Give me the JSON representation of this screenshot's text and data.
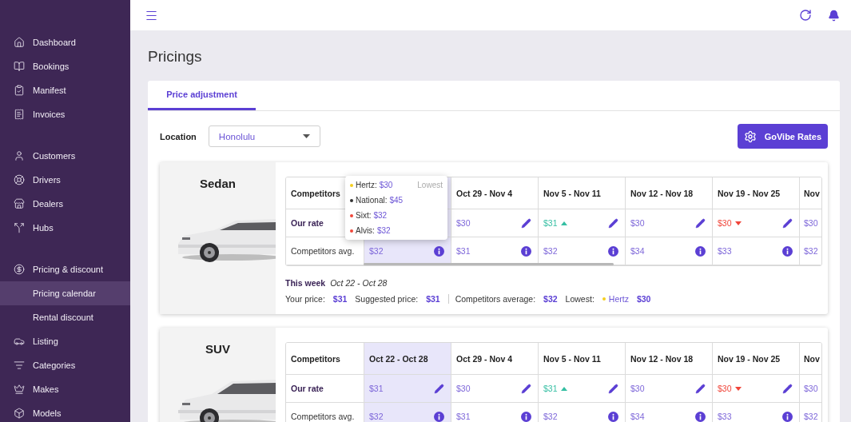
{
  "sidebar": {
    "groups": [
      {
        "items": [
          {
            "label": "Dashboard",
            "selected": false
          },
          {
            "label": "Bookings",
            "selected": false
          },
          {
            "label": "Manifest",
            "selected": false
          },
          {
            "label": "Invoices",
            "selected": false
          }
        ]
      },
      {
        "items": [
          {
            "label": "Customers",
            "selected": false
          },
          {
            "label": "Drivers",
            "selected": false
          },
          {
            "label": "Dealers",
            "selected": false
          },
          {
            "label": "Hubs",
            "selected": false
          }
        ]
      },
      {
        "items": [
          {
            "label": "Pricing & discount",
            "selected": false,
            "expanded": true,
            "children": [
              {
                "label": "Pricing calendar",
                "selected": true
              },
              {
                "label": "Rental discount",
                "selected": false
              }
            ]
          },
          {
            "label": "Listing",
            "selected": false
          },
          {
            "label": "Categories",
            "selected": false
          },
          {
            "label": "Makes",
            "selected": false
          },
          {
            "label": "Models",
            "selected": false
          }
        ]
      }
    ]
  },
  "page": {
    "title": "Pricings"
  },
  "tabs": [
    {
      "label": "Price adjustment",
      "selected": true
    }
  ],
  "location": {
    "label": "Location",
    "value": "Honolulu"
  },
  "rates_button": "GoVibe Rates",
  "vehicles": [
    {
      "name": "Sedan",
      "header": "Competitors",
      "rate_label": "Our rate",
      "avg_label": "Competitors avg.",
      "weeks": [
        {
          "selected": true,
          "avg": "$32"
        },
        {
          "range": "Oct 29 - Nov 4",
          "selected": false,
          "rate": "$30",
          "kind": "flat",
          "avg": "$31"
        },
        {
          "range": "Nov 5 - Nov 11",
          "selected": false,
          "rate": "$31",
          "kind": "up",
          "avg": "$32"
        },
        {
          "range": "Nov 12 - Nov 18",
          "selected": false,
          "rate": "$30",
          "kind": "flat",
          "avg": "$34"
        },
        {
          "range": "Nov 19 - Nov 25",
          "selected": false,
          "rate": "$30",
          "kind": "down",
          "avg": "$33"
        },
        {
          "range": "Nov",
          "selected": false,
          "rate": "$30",
          "kind": "flat",
          "avg": "$32"
        }
      ],
      "tooltip": [
        {
          "name": "Hertz:",
          "price": "$30",
          "color": "#f5cf1f",
          "note": "Lowest"
        },
        {
          "name": "National:",
          "price": "$45",
          "color": "#333333"
        },
        {
          "name": "Sixt:",
          "price": "$32",
          "color": "#f0473a"
        },
        {
          "name": "Alvis:",
          "price": "$32",
          "color": "#f0473a"
        }
      ],
      "this_week": {
        "label": "This week",
        "range": "Oct 22 - Oct 28"
      },
      "summary": [
        {
          "label": "Your price:",
          "value": "$31",
          "separator": false
        },
        {
          "label": "Suggested price:",
          "value": "$31",
          "separator": false
        },
        {
          "label": "Competitors average:",
          "value": "$32",
          "separator": true
        }
      ],
      "lowest": {
        "label": "Lowest:",
        "name": "Hertz",
        "value": "$30",
        "color": "#f5cf1f"
      }
    },
    {
      "name": "SUV",
      "header": "Competitors",
      "rate_label": "Our rate",
      "avg_label": "Competitors avg.",
      "weeks": [
        {
          "range": "Oct 22 - Oct 28",
          "selected": true,
          "rate": "$31",
          "kind": "flat",
          "avg": "$32"
        },
        {
          "range": "Oct 29 - Nov 4",
          "selected": false,
          "rate": "$30",
          "kind": "flat",
          "avg": "$31"
        },
        {
          "range": "Nov 5 - Nov 11",
          "selected": false,
          "rate": "$31",
          "kind": "up",
          "avg": "$32"
        },
        {
          "range": "Nov 12 - Nov 18",
          "selected": false,
          "rate": "$30",
          "kind": "flat",
          "avg": "$34"
        },
        {
          "range": "Nov 19 - Nov 25",
          "selected": false,
          "rate": "$30",
          "kind": "down",
          "avg": "$33"
        },
        {
          "range": "Nov",
          "selected": false,
          "rate": "$30",
          "kind": "flat",
          "avg": "$32"
        }
      ]
    }
  ]
}
